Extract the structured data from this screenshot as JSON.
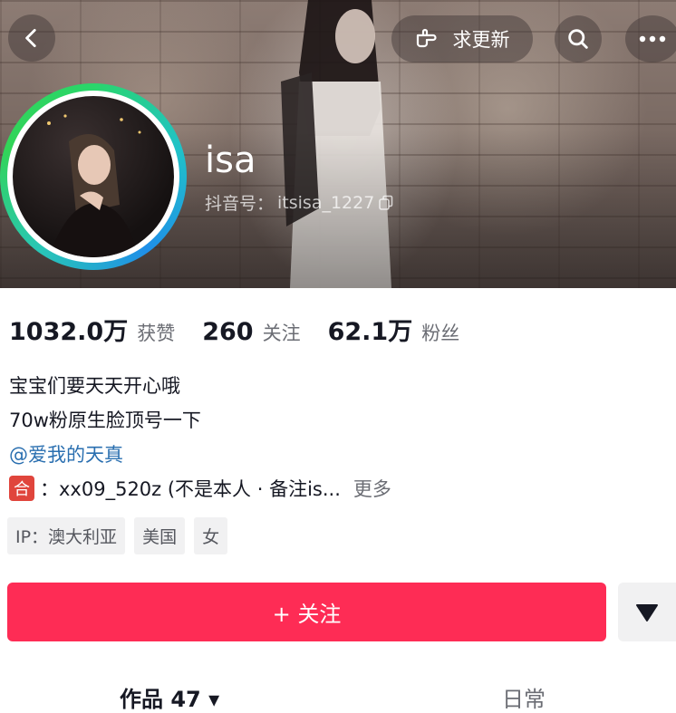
{
  "header": {
    "update_label": "求更新"
  },
  "profile": {
    "username": "isa",
    "douyin_id_label": "抖音号：",
    "douyin_id": "itsisa_1227"
  },
  "stats": [
    {
      "value": "1032.0万",
      "label": "获赞"
    },
    {
      "value": "260",
      "label": "关注"
    },
    {
      "value": "62.1万",
      "label": "粉丝"
    }
  ],
  "bio": {
    "line1": "宝宝们要天天开心哦",
    "line2": "70w粉原生脸顶号一下",
    "mention": "@爱我的天真",
    "contact_icon": "合",
    "contact_text": "：xx09_520z (不是本人 · 备注is...",
    "more": "更多"
  },
  "tags": [
    "IP：澳大利亚",
    "美国",
    "女"
  ],
  "actions": {
    "follow": "+ 关注"
  },
  "tabs": {
    "works": "作品 47 ▾",
    "daily": "日常"
  },
  "colors": {
    "follow": "#fe2c55",
    "mention": "#2a6fb0",
    "ring": "#2ad66a"
  },
  "icons": [
    "back-icon",
    "hand-pointer-icon",
    "search-icon",
    "more-icon",
    "copy-icon",
    "triangle-down-icon"
  ]
}
